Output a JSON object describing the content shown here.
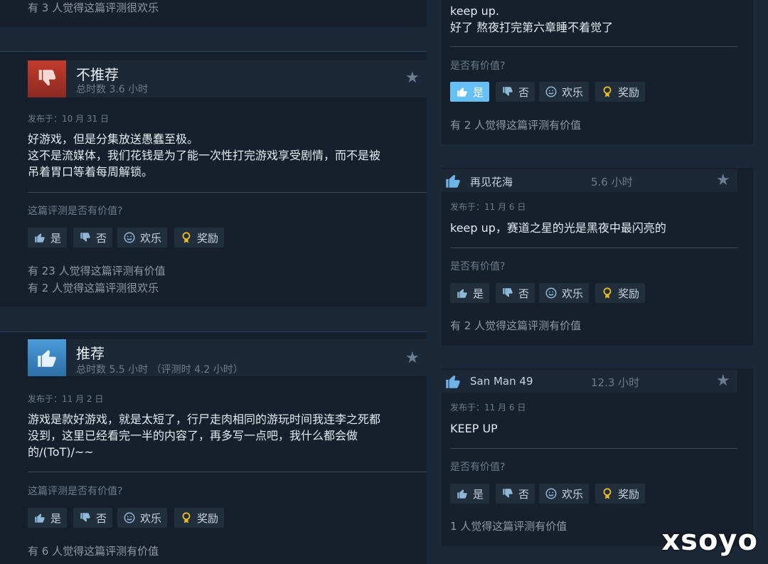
{
  "left": {
    "top_stat": "有 3 人觉得这篇评测很欢乐",
    "reviews": [
      {
        "verdict": "不推荐",
        "hours": "总时数 3.6 小时",
        "posted": "发布于：10 月 31 日",
        "body": "好游戏，但是分集放送愚蠢至极。\n这不是流媒体，我们花钱是为了能一次性打完游戏享受剧情，而不是被\n吊着胃口等着每周解锁。",
        "question": "这篇评测是否有价值?",
        "btn_yes": "是",
        "btn_no": "否",
        "btn_funny": "欢乐",
        "btn_award": "奖励",
        "stat1": "有 23 人觉得这篇评测有价值",
        "stat2": "有 2 人觉得这篇评测很欢乐"
      },
      {
        "verdict": "推荐",
        "hours": "总时数 5.5 小时 （评测时 4.2 小时）",
        "posted": "发布于：11 月 2 日",
        "body": "游戏是款好游戏，就是太短了，行尸走肉相同的游玩时间我连李之死都\n没到，这里已经看完一半的内容了，再多写一点吧，我什么都会做\n的/(ToT)/~~",
        "question": "这篇评测是否有价值?",
        "btn_yes": "是",
        "btn_no": "否",
        "btn_funny": "欢乐",
        "btn_award": "奖励",
        "stat1": "有 6 人觉得这篇评测有价值"
      }
    ]
  },
  "right": {
    "top_review": {
      "body": "keep up.\n好了 熬夜打完第六章睡不着觉了",
      "question": "是否有价值?",
      "btn_yes": "是",
      "btn_no": "否",
      "btn_funny": "欢乐",
      "btn_award": "奖励",
      "stat": "有 2 人觉得这篇评测有价值"
    },
    "reviews": [
      {
        "name": "再见花海",
        "hours": "5.6 小时",
        "posted": "发布于：11 月 6 日",
        "body": "keep up，赛道之星的光是黑夜中最闪亮的",
        "question": "是否有价值?",
        "btn_yes": "是",
        "btn_no": "否",
        "btn_funny": "欢乐",
        "btn_award": "奖励",
        "stat": "有 2 人觉得这篇评测有价值"
      },
      {
        "name": "San Man 49",
        "hours": "12.3 小时",
        "posted": "发布于：11 月 6 日",
        "body": "KEEP UP",
        "question": "是否有价值?",
        "btn_yes": "是",
        "btn_no": "否",
        "btn_funny": "欢乐",
        "btn_award": "奖励",
        "stat": "1 人觉得这篇评测有价值"
      }
    ]
  },
  "watermark": "xsoyo",
  "colors": {
    "accent": "#66c0f4",
    "background": "#1b2838",
    "card": "#16202d",
    "award": "#e8b923"
  }
}
